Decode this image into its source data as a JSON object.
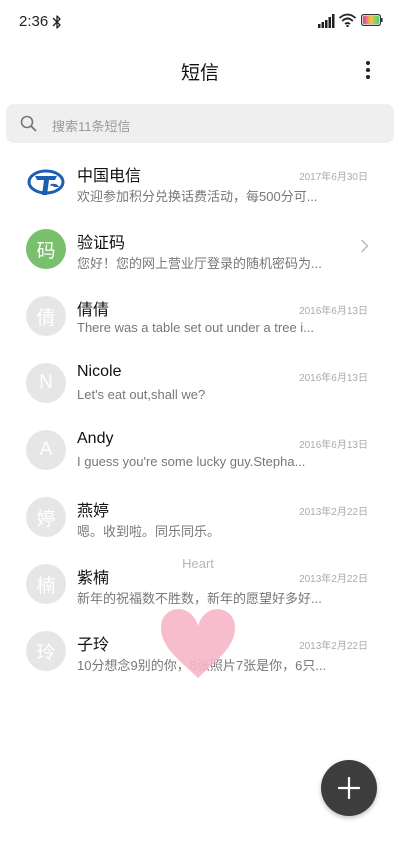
{
  "status_bar": {
    "time": "2:36"
  },
  "header": {
    "title": "短信"
  },
  "search": {
    "placeholder": "搜索11条短信"
  },
  "conversations": [
    {
      "avatar": "",
      "avatar_style": "china-telecom-logo",
      "name": "中国电信",
      "date": "2017年6月30日",
      "preview": "欢迎参加积分兑换话费活动，每500分可..."
    },
    {
      "avatar": "码",
      "avatar_color": "#79c06c",
      "name": "验证码",
      "date": "",
      "preview": "您好！您的网上营业厅登录的随机密码为..."
    },
    {
      "avatar": "倩",
      "name": "倩倩",
      "date": "2016年6月13日",
      "preview": "There was a table set out under a tree i..."
    },
    {
      "avatar": "N",
      "name": "Nicole",
      "date": "2016年6月13日",
      "preview": "Let's eat out,shall we?"
    },
    {
      "avatar": "A",
      "name": "Andy",
      "date": "2016年6月13日",
      "preview": "I guess you're some lucky guy.Stepha..."
    },
    {
      "avatar": "婷",
      "name": "燕婷",
      "date": "2013年2月22日",
      "preview": "嗯。收到啦。同乐同乐。"
    },
    {
      "avatar": "楠",
      "name": "紫楠",
      "date": "2013年2月22日",
      "preview": "新年的祝福数不胜数，新年的愿望好多好..."
    },
    {
      "avatar": "玲",
      "name": "子玲",
      "date": "2013年2月22日",
      "preview": "10分想念9别的你，8张照片7张是你，6只..."
    }
  ],
  "overlay": {
    "label": "Heart",
    "color": "#f7b6c8"
  },
  "colors": {
    "fab": "#3d3d3d",
    "search_bg": "#efefef",
    "default_avatar": "#e6e6e6"
  },
  "icons": [
    "bluetooth-icon",
    "signal-icon",
    "wifi-icon",
    "battery-icon",
    "more-icon",
    "search-icon",
    "chevron-right-icon",
    "plus-icon",
    "heart-icon"
  ]
}
